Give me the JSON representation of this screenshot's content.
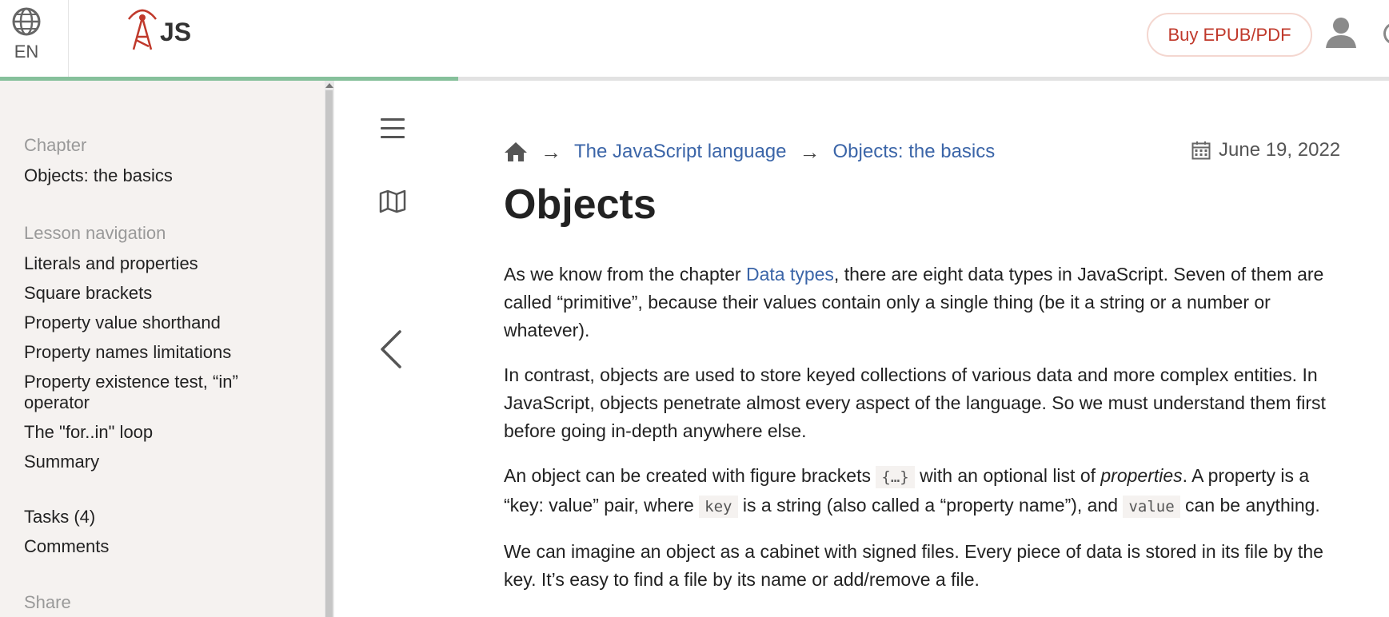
{
  "header": {
    "lang_label": "EN",
    "logo_text": "JS",
    "buy_label": "Buy EPUB/PDF",
    "progress_fraction": 0.33
  },
  "sidebar": {
    "chapter_heading": "Chapter",
    "chapter_title": "Objects: the basics",
    "lesson_heading": "Lesson navigation",
    "lesson_items": [
      "Literals and properties",
      "Square brackets",
      "Property value shorthand",
      "Property names limitations",
      "Property existence test, “in” operator",
      "The \"for..in\" loop",
      "Summary"
    ],
    "tasks_label": "Tasks (4)",
    "comments_label": "Comments",
    "share_heading": "Share"
  },
  "breadcrumb": {
    "arrow": "→",
    "items": [
      "The JavaScript language",
      "Objects: the basics"
    ]
  },
  "date": "June 19, 2022",
  "article": {
    "title": "Objects",
    "p1_before": "As we know from the chapter ",
    "p1_link": "Data types",
    "p1_after": ", there are eight data types in JavaScript. Seven of them are called “primitive”, because their values contain only a single thing (be it a string or a number or whatever).",
    "p2": "In contrast, objects are used to store keyed collections of various data and more complex entities. In JavaScript, objects penetrate almost every aspect of the language. So we must understand them first before going in-depth anywhere else.",
    "p3_a": "An object can be created with figure brackets ",
    "p3_code1": "{…}",
    "p3_b": " with an optional list of ",
    "p3_em": "properties",
    "p3_c": ". A property is a “key: value” pair, where ",
    "p3_code2": "key",
    "p3_d": " is a string (also called a “property name”), and ",
    "p3_code3": "value",
    "p3_e": " can be anything.",
    "p4": "We can imagine an object as a cabinet with signed files. Every piece of data is stored in its file by the key. It’s easy to find a file by its name or add/remove a file."
  },
  "icons": {
    "globe": "globe-icon",
    "logo": "logo-tower-icon",
    "user": "user-icon",
    "menu": "hamburger-icon",
    "map": "map-icon",
    "prev": "chevron-left-icon",
    "home": "home-icon",
    "calendar": "calendar-icon"
  },
  "colors": {
    "link": "#3b65a8",
    "accent": "#c0392b",
    "progress": "#86c09b",
    "sidebar_bg": "#f5f2f0"
  }
}
